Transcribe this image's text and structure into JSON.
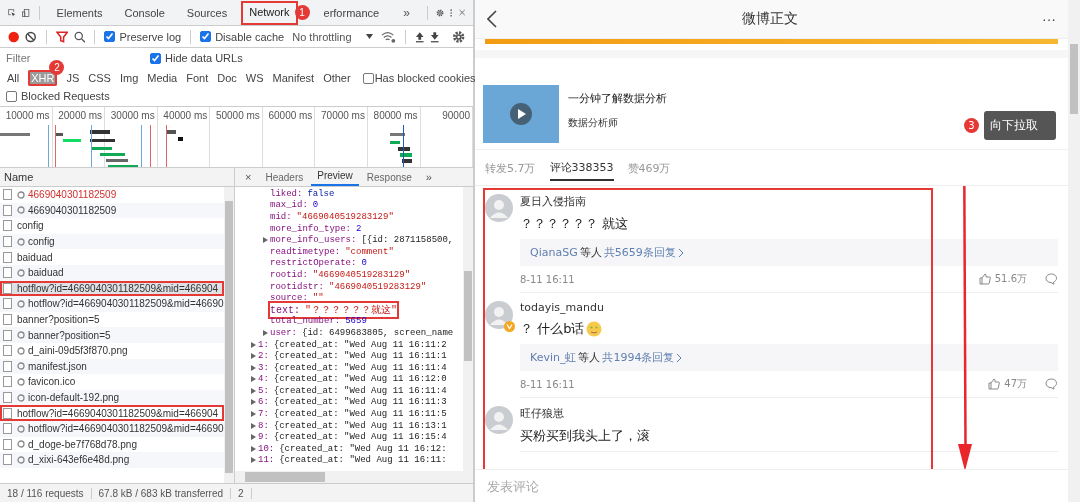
{
  "devtools": {
    "tabs": [
      {
        "label": "Elements",
        "selected": false,
        "highlighted": false
      },
      {
        "label": "Console",
        "selected": false,
        "highlighted": false
      },
      {
        "label": "Sources",
        "selected": false,
        "highlighted": false
      },
      {
        "label": "Network",
        "selected": true,
        "highlighted": true,
        "badge": "1"
      },
      {
        "label": "erformance",
        "selected": false,
        "highlighted": false
      }
    ],
    "more_tabs": "»",
    "toolbar": {
      "preserve_log": {
        "label": "Preserve log",
        "checked": true
      },
      "disable_cache": {
        "label": "Disable cache",
        "checked": true
      },
      "throttling": "No throttling"
    },
    "filter": {
      "placeholder": "Filter",
      "hide_data_urls": {
        "label": "Hide data URLs",
        "checked": true
      }
    },
    "types": [
      {
        "label": "All",
        "selected": false,
        "highlighted": false
      },
      {
        "label": "XHR",
        "selected": true,
        "highlighted": true,
        "badge": "2"
      },
      {
        "label": "JS",
        "selected": false,
        "highlighted": false
      },
      {
        "label": "CSS",
        "selected": false,
        "highlighted": false
      },
      {
        "label": "Img",
        "selected": false,
        "highlighted": false
      },
      {
        "label": "Media",
        "selected": false,
        "highlighted": false
      },
      {
        "label": "Font",
        "selected": false,
        "highlighted": false
      },
      {
        "label": "Doc",
        "selected": false,
        "highlighted": false
      },
      {
        "label": "WS",
        "selected": false,
        "highlighted": false
      },
      {
        "label": "Manifest",
        "selected": false,
        "highlighted": false
      },
      {
        "label": "Other",
        "selected": false,
        "highlighted": false
      }
    ],
    "has_blocked_cookies": {
      "label": "Has blocked cookies",
      "checked": false
    },
    "blocked_requests": {
      "label": "Blocked Requests",
      "checked": false
    },
    "timeline_ticks": [
      "10000 ms",
      "20000 ms",
      "30000 ms",
      "40000 ms",
      "50000 ms",
      "60000 ms",
      "70000 ms",
      "80000 ms",
      "90000"
    ],
    "requests": {
      "header": "Name",
      "rows": [
        {
          "name": "4669040301182509",
          "gear": true,
          "error": true,
          "selected": false,
          "highlighted": false
        },
        {
          "name": "4669040301182509",
          "gear": true,
          "error": false,
          "selected": false,
          "highlighted": false
        },
        {
          "name": "config",
          "gear": false,
          "error": false,
          "selected": false,
          "highlighted": false
        },
        {
          "name": "config",
          "gear": true,
          "error": false,
          "selected": false,
          "highlighted": false
        },
        {
          "name": "baiduad",
          "gear": false,
          "error": false,
          "selected": false,
          "highlighted": false
        },
        {
          "name": "baiduad",
          "gear": true,
          "error": false,
          "selected": false,
          "highlighted": false
        },
        {
          "name": "hotflow?id=4669040301182509&mid=466904",
          "gear": false,
          "error": false,
          "selected": true,
          "highlighted": true
        },
        {
          "name": "hotflow?id=4669040301182509&mid=46690",
          "gear": true,
          "error": false,
          "selected": false,
          "highlighted": false
        },
        {
          "name": "banner?position=5",
          "gear": false,
          "error": false,
          "selected": false,
          "highlighted": false
        },
        {
          "name": "banner?position=5",
          "gear": true,
          "error": false,
          "selected": false,
          "highlighted": false
        },
        {
          "name": "d_aini-09d5f3f870.png",
          "gear": true,
          "error": false,
          "selected": false,
          "highlighted": false
        },
        {
          "name": "manifest.json",
          "gear": true,
          "error": false,
          "selected": false,
          "highlighted": false
        },
        {
          "name": "favicon.ico",
          "gear": true,
          "error": false,
          "selected": false,
          "highlighted": false
        },
        {
          "name": "icon-default-192.png",
          "gear": true,
          "error": false,
          "selected": false,
          "highlighted": false
        },
        {
          "name": "hotflow?id=4669040301182509&mid=466904",
          "gear": false,
          "error": false,
          "selected": false,
          "highlighted": true
        },
        {
          "name": "hotflow?id=4669040301182509&mid=46690",
          "gear": true,
          "error": false,
          "selected": false,
          "highlighted": false
        },
        {
          "name": "d_doge-be7f768d78.png",
          "gear": true,
          "error": false,
          "selected": false,
          "highlighted": false
        },
        {
          "name": "d_xixi-643ef6e48d.png",
          "gear": true,
          "error": false,
          "selected": false,
          "highlighted": false
        }
      ]
    },
    "status": [
      "18 / 116 requests",
      "67.8 kB / 683 kB transferred",
      "2"
    ],
    "preview": {
      "close": "×",
      "tabs": [
        {
          "label": "Headers",
          "selected": false
        },
        {
          "label": "Preview",
          "selected": true
        },
        {
          "label": "Response",
          "selected": false
        }
      ],
      "more_tabs": "»",
      "fields": [
        {
          "key": "liked:",
          "value": "false",
          "kind": "bool",
          "expandable": false,
          "highlighted": false
        },
        {
          "key": "max_id:",
          "value": "0",
          "kind": "number",
          "expandable": false,
          "highlighted": false
        },
        {
          "key": "mid:",
          "value": "\"4669040519283129\"",
          "kind": "string",
          "expandable": false,
          "highlighted": false
        },
        {
          "key": "more_info_type:",
          "value": "2",
          "kind": "number",
          "expandable": false,
          "highlighted": false
        },
        {
          "key": "more_info_users:",
          "value": "[{id: 2871158500,",
          "kind": "object",
          "expandable": true,
          "highlighted": false
        },
        {
          "key": "readtimetype:",
          "value": "\"comment\"",
          "kind": "string",
          "expandable": false,
          "highlighted": false
        },
        {
          "key": "restrictOperate:",
          "value": "0",
          "kind": "number",
          "expandable": false,
          "highlighted": false
        },
        {
          "key": "rootid:",
          "value": "\"4669040519283129\"",
          "kind": "string",
          "expandable": false,
          "highlighted": false
        },
        {
          "key": "rootidstr:",
          "value": "\"4669040519283129\"",
          "kind": "string",
          "expandable": false,
          "highlighted": false
        },
        {
          "key": "source:",
          "value": "\"\"",
          "kind": "string",
          "expandable": false,
          "highlighted": false
        },
        {
          "key": "text:",
          "value": "\"？？？？？？就这\"",
          "kind": "string",
          "expandable": false,
          "highlighted": true
        },
        {
          "key": "total_number:",
          "value": "5659",
          "kind": "number",
          "expandable": false,
          "highlighted": false
        },
        {
          "key": "user:",
          "value": "{id: 6499683805, screen_name",
          "kind": "object",
          "expandable": true,
          "highlighted": false
        }
      ],
      "items": [
        {
          "key": "1:",
          "value": "{created_at: \"Wed Aug 11 16:11:2"
        },
        {
          "key": "2:",
          "value": "{created_at: \"Wed Aug 11 16:11:1"
        },
        {
          "key": "3:",
          "value": "{created_at: \"Wed Aug 11 16:11:4"
        },
        {
          "key": "4:",
          "value": "{created_at: \"Wed Aug 11 16:12:0"
        },
        {
          "key": "5:",
          "value": "{created_at: \"Wed Aug 11 16:11:4"
        },
        {
          "key": "6:",
          "value": "{created_at: \"Wed Aug 11 16:11:3"
        },
        {
          "key": "7:",
          "value": "{created_at: \"Wed Aug 11 16:11:5"
        },
        {
          "key": "8:",
          "value": "{created_at: \"Wed Aug 11 16:13:1"
        },
        {
          "key": "9:",
          "value": "{created_at: \"Wed Aug 11 16:15:4"
        },
        {
          "key": "10:",
          "value": "{created_at: \"Wed Aug 11 16:12:"
        },
        {
          "key": "11:",
          "value": "{created_at: \"Wed Aug 11 16:11:"
        }
      ]
    }
  },
  "weibo": {
    "title": "微博正文",
    "more": "···",
    "ad": {
      "title": "一分钟了解数据分析",
      "author": "数据分析师"
    },
    "tooltip": {
      "badge": "3",
      "text": "向下拉取"
    },
    "stats": [
      {
        "label": "转发5.7万",
        "selected": false
      },
      {
        "label": "评论338353",
        "selected": true
      },
      {
        "label": "赞469万",
        "selected": false
      }
    ],
    "comments": [
      {
        "name": "夏日入侵指南",
        "verified": false,
        "text": "？？？？？？ 就这",
        "emoji": false,
        "reply": {
          "users": "QianaSG",
          "suffix": "等人",
          "count": "共5659条回复"
        },
        "time": "8-11 16:11",
        "likes": "51.6万"
      },
      {
        "name": "todayis_mandu",
        "verified": true,
        "text": "？ 什么b话",
        "emoji": true,
        "reply": {
          "users": "Kevin_虹",
          "suffix": "等人",
          "count": "共1994条回复"
        },
        "time": "8-11 16:11",
        "likes": "47万"
      },
      {
        "name": "旺仔狼崽",
        "verified": false,
        "text": "买粉买到我头上了，滚",
        "emoji": false
      }
    ],
    "compose": {
      "placeholder": "发表评论"
    }
  }
}
